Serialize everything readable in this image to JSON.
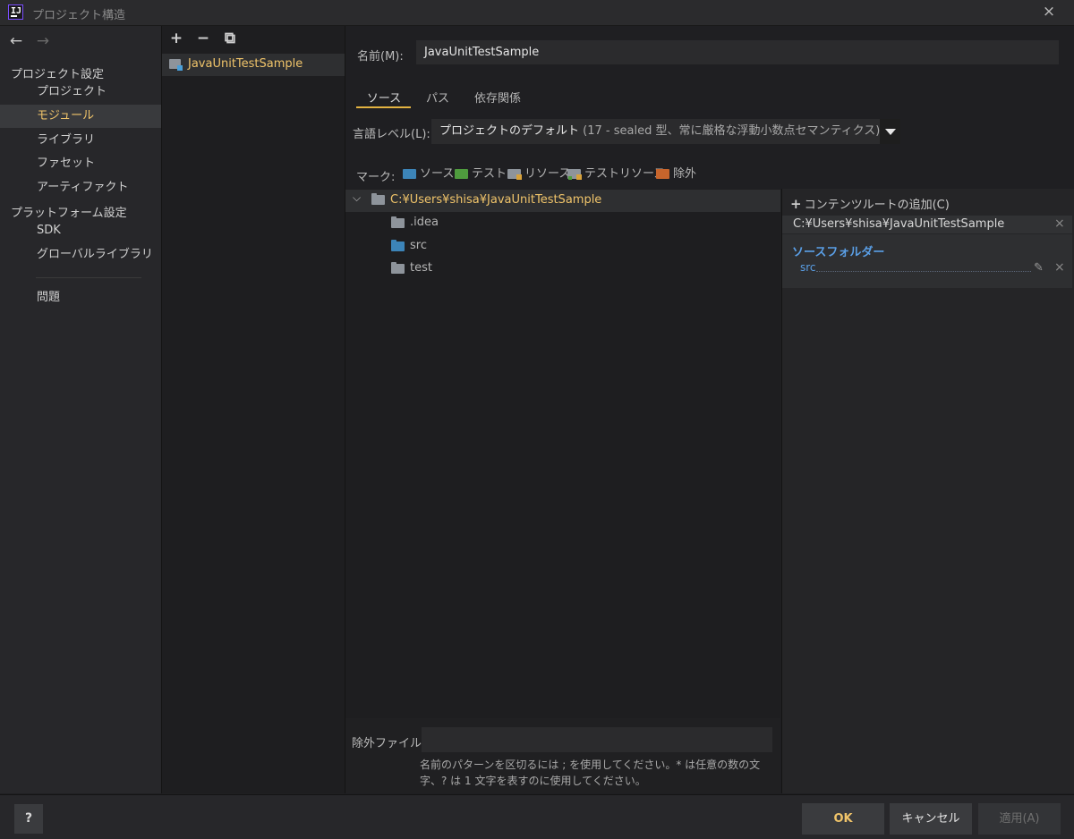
{
  "window": {
    "title": "プロジェクト構造",
    "close_icon": "×"
  },
  "nav": {
    "back_icon": "←",
    "forward_icon": "→",
    "section_project": "プロジェクト設定",
    "items_project": [
      "プロジェクト",
      "モジュール",
      "ライブラリ",
      "ファセット",
      "アーティファクト"
    ],
    "section_platform": "プラットフォーム設定",
    "items_platform": [
      "SDK",
      "グローバルライブラリ"
    ],
    "problems": "問題",
    "selected": "モジュール"
  },
  "modules": {
    "toolbar": {
      "add": "+",
      "remove": "−",
      "copy": "⧉"
    },
    "items": [
      "JavaUnitTestSample"
    ]
  },
  "module": {
    "name_label": "名前(M):",
    "name_value": "JavaUnitTestSample",
    "tabs": [
      "ソース",
      "パス",
      "依存関係"
    ],
    "active_tab": "ソース",
    "language_level_label": "言語レベル(L):",
    "language_level_value": "プロジェクトのデフォルト",
    "language_level_detail": "(17 - sealed 型、常に厳格な浮動小数点セマンティクス)",
    "mark_label": "マーク:",
    "mark_buttons": [
      "ソース",
      "テスト",
      "リソース",
      "テストリソース",
      "除外"
    ]
  },
  "tree": {
    "root": "C:¥Users¥shisa¥JavaUnitTestSample",
    "children": [
      ".idea",
      "src",
      "test"
    ]
  },
  "content_root": {
    "add_label": "コンテンツルートの追加(C)",
    "path": "C:¥Users¥shisa¥JavaUnitTestSample",
    "source_folders_title": "ソースフォルダー",
    "source_entry": "src",
    "close_icon": "×",
    "edit_icon": "✎"
  },
  "exclude": {
    "label": "除外ファイル:",
    "value": "",
    "hint": "名前のパターンを区切るには ; を使用してください。* は任意の数の文字、? は 1 文字を表すのに使用してください。"
  },
  "footer": {
    "help": "?",
    "ok": "OK",
    "cancel": "キャンセル",
    "apply": "適用(A)"
  },
  "colors": {
    "accent": "#f0c46a",
    "source": "#3c84b8",
    "test": "#4f9c3e",
    "excluded": "#c7652c",
    "link": "#5a9fe6"
  }
}
